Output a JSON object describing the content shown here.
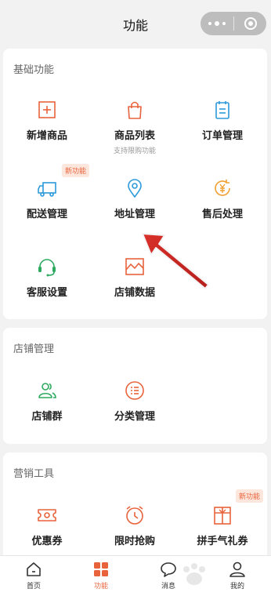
{
  "nav": {
    "title": "功能"
  },
  "sections": {
    "basic": {
      "title": "基础功能",
      "items": [
        {
          "label": "新增商品",
          "icon": "add-icon"
        },
        {
          "label": "商品列表",
          "sub": "支持限购功能",
          "icon": "shopping-bag-icon"
        },
        {
          "label": "订单管理",
          "icon": "clipboard-icon"
        },
        {
          "label": "配送管理",
          "icon": "truck-icon",
          "badge": "新功能"
        },
        {
          "label": "地址管理",
          "icon": "location-pin-icon"
        },
        {
          "label": "售后处理",
          "icon": "refund-yen-icon"
        },
        {
          "label": "客服设置",
          "icon": "headset-icon"
        },
        {
          "label": "店铺数据",
          "icon": "chart-icon"
        }
      ]
    },
    "store": {
      "title": "店铺管理",
      "items": [
        {
          "label": "店铺群",
          "icon": "group-icon"
        },
        {
          "label": "分类管理",
          "icon": "list-icon"
        }
      ]
    },
    "marketing": {
      "title": "营销工具",
      "items": [
        {
          "label": "优惠券",
          "icon": "coupon-icon"
        },
        {
          "label": "限时抢购",
          "icon": "alarm-clock-icon"
        },
        {
          "label": "拼手气礼券",
          "icon": "gift-icon",
          "badge": "新功能"
        }
      ]
    }
  },
  "tabs": [
    {
      "label": "首页",
      "icon": "home-icon"
    },
    {
      "label": "功能",
      "icon": "grid-icon",
      "active": true
    },
    {
      "label": "消息",
      "icon": "chat-icon"
    },
    {
      "label": "我的",
      "icon": "user-icon"
    }
  ],
  "colors": {
    "accent": "#e8633c",
    "blue": "#2c9ad9",
    "green": "#2eaa5f",
    "orange": "#f0a030"
  }
}
